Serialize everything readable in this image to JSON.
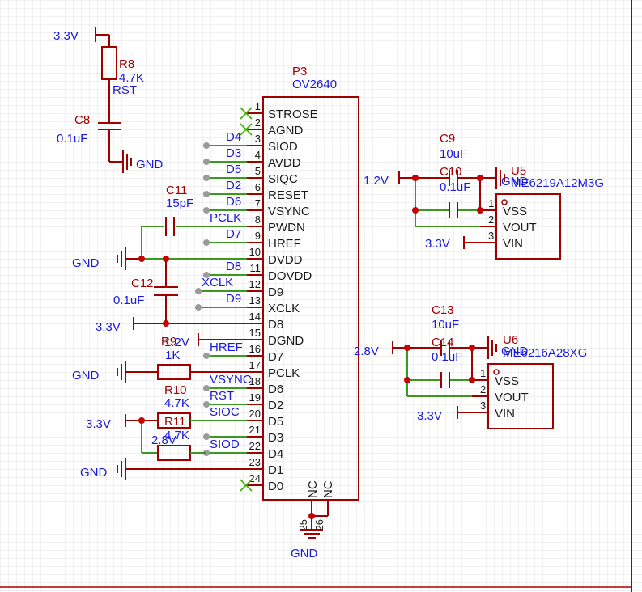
{
  "colors": {
    "grid": "#e3e3e3",
    "wire": "#3a9a20",
    "part": "#a00000",
    "label": "#1a1adf",
    "junction": "#c80000"
  },
  "p3": {
    "ref": "P3",
    "value": "OV2640",
    "pins": [
      {
        "num": "1",
        "name": "STROSE"
      },
      {
        "num": "2",
        "name": "AGND"
      },
      {
        "num": "3",
        "name": "SIOD"
      },
      {
        "num": "4",
        "name": "AVDD"
      },
      {
        "num": "5",
        "name": "SIQC"
      },
      {
        "num": "6",
        "name": "RESET"
      },
      {
        "num": "7",
        "name": "VSYNC"
      },
      {
        "num": "8",
        "name": "PWDN"
      },
      {
        "num": "9",
        "name": "HREF"
      },
      {
        "num": "10",
        "name": "DVDD"
      },
      {
        "num": "11",
        "name": "DOVDD"
      },
      {
        "num": "12",
        "name": "D9"
      },
      {
        "num": "13",
        "name": "XCLK"
      },
      {
        "num": "14",
        "name": "D8"
      },
      {
        "num": "15",
        "name": "DGND"
      },
      {
        "num": "16",
        "name": "D7"
      },
      {
        "num": "17",
        "name": "PCLK"
      },
      {
        "num": "18",
        "name": "D6"
      },
      {
        "num": "19",
        "name": "D2"
      },
      {
        "num": "20",
        "name": "D5"
      },
      {
        "num": "21",
        "name": "D3"
      },
      {
        "num": "22",
        "name": "D4"
      },
      {
        "num": "23",
        "name": "D1"
      },
      {
        "num": "24",
        "name": "D0"
      }
    ],
    "bottom_pins": [
      {
        "num": "25",
        "name": "NC"
      },
      {
        "num": "26",
        "name": "NC"
      }
    ]
  },
  "net_labels": [
    "D4",
    "D3",
    "D5",
    "D2",
    "D6",
    "PCLK",
    "D7",
    "D8",
    "XCLK",
    "D9",
    "HREF",
    "VSYNC",
    "RST",
    "SIOC",
    "SIOD"
  ],
  "power": {
    "v33": "3.3V",
    "v12": "1.2V",
    "v28": "2.8V",
    "gnd": "GND"
  },
  "passives": {
    "r8": {
      "ref": "R8",
      "value": "4.7K",
      "net": "RST"
    },
    "c8": {
      "ref": "C8",
      "value": "0.1uF"
    },
    "c11": {
      "ref": "C11",
      "value": "15pF"
    },
    "c12": {
      "ref": "C12",
      "value": "0.1uF"
    },
    "r9": {
      "ref": "R9",
      "value": "1K"
    },
    "r10": {
      "ref": "R10",
      "value": "4.7K"
    },
    "r11": {
      "ref": "R11",
      "value": "4.7K"
    },
    "c9": {
      "ref": "C9",
      "value": "10uF"
    },
    "c10": {
      "ref": "C10",
      "value": "0.1uF"
    },
    "c13": {
      "ref": "C13",
      "value": "10uF"
    },
    "c14": {
      "ref": "C14",
      "value": "0.1uF"
    }
  },
  "u5": {
    "ref": "U5",
    "value": "ME6219A12M3G",
    "pins": [
      {
        "num": "1",
        "name": "VSS"
      },
      {
        "num": "2",
        "name": "VOUT"
      },
      {
        "num": "3",
        "name": "VIN"
      }
    ]
  },
  "u6": {
    "ref": "U6",
    "value": "ME6216A28XG",
    "pins": [
      {
        "num": "1",
        "name": "VSS"
      },
      {
        "num": "2",
        "name": "VOUT"
      },
      {
        "num": "3",
        "name": "VIN"
      }
    ]
  }
}
